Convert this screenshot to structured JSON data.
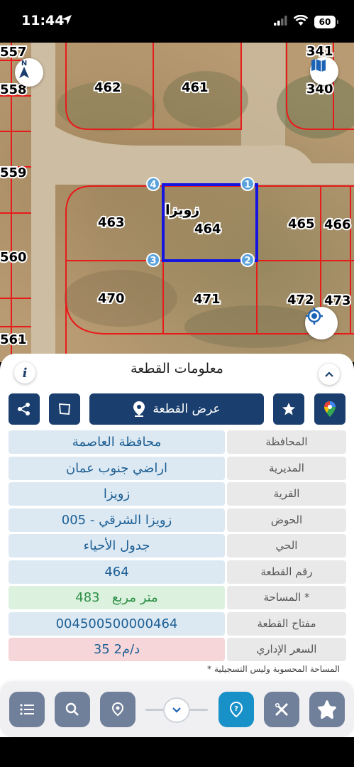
{
  "status_bar": {
    "time": "11:44",
    "battery": "60"
  },
  "map": {
    "parcels": [
      "557",
      "558",
      "559",
      "560",
      "561",
      "462",
      "461",
      "463",
      "464",
      "465",
      "466",
      "470",
      "471",
      "472",
      "473",
      "341",
      "340"
    ],
    "vertices": [
      "1",
      "2",
      "3",
      "4"
    ],
    "village_label": "زويزا",
    "colors": {
      "parcel_line": "#e81b1b",
      "selected": "#1515e0",
      "vertex": "#5aa2dc"
    }
  },
  "panel": {
    "title": "معلومات القطعة",
    "show_parcel_label": "عرض القطعة",
    "rows": [
      {
        "key": "المحافظة",
        "value": "محافظة العاصمة"
      },
      {
        "key": "المديرية",
        "value": "اراضي جنوب عمان"
      },
      {
        "key": "القرية",
        "value": "زويزا"
      },
      {
        "key": "الحوض",
        "value": "زويزا الشرقي - 005"
      },
      {
        "key": "الحي",
        "value": "جدول الأحياء"
      },
      {
        "key": "رقم القطعة",
        "value": "464"
      },
      {
        "key": "المساحة *",
        "value": "483   متر مربع"
      },
      {
        "key": "مفتاح القطعة",
        "value": "004500500000464"
      },
      {
        "key": "السعر الإداري",
        "value": "35 د/م2"
      }
    ],
    "footnote": "* المساحة المحسوبة وليس التسجيلية",
    "colors": {
      "toolbar": "#1a3e6e",
      "value_bg": "#dce9f3",
      "value_text": "#1d5f94"
    }
  },
  "nav": {
    "icons": [
      "list-icon",
      "search-icon",
      "location-pin-icon",
      "chevron-down-icon",
      "help-pin-icon",
      "measure-icon",
      "star-icon"
    ]
  }
}
